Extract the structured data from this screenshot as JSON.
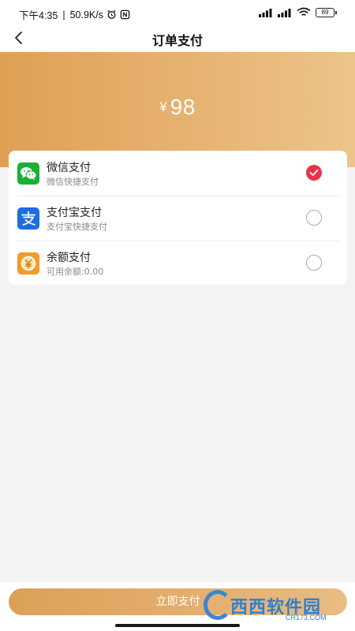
{
  "status_bar": {
    "time": "下午4:35",
    "net_speed": "50.9K/s",
    "battery": "89"
  },
  "header": {
    "title": "订单支付"
  },
  "order": {
    "currency": "¥",
    "amount": "98"
  },
  "payment_methods": [
    {
      "title": "微信支付",
      "subtitle": "微信快捷支付",
      "icon": "wechat-pay-icon",
      "color": "#19b035",
      "selected": true
    },
    {
      "title": "支付宝支付",
      "subtitle": "支付宝快捷支付",
      "icon": "alipay-icon",
      "color": "#1d6ce0",
      "selected": false
    },
    {
      "title": "余额支付",
      "subtitle": "可用余额:0.00",
      "icon": "balance-icon",
      "color": "#f29b2a",
      "selected": false
    }
  ],
  "footer": {
    "pay_label": "立即支付"
  },
  "watermark": {
    "brand": "西西软件园",
    "site": "CR173.COM"
  },
  "colors": {
    "accent": "#e3a864",
    "selected": "#e8334a"
  }
}
